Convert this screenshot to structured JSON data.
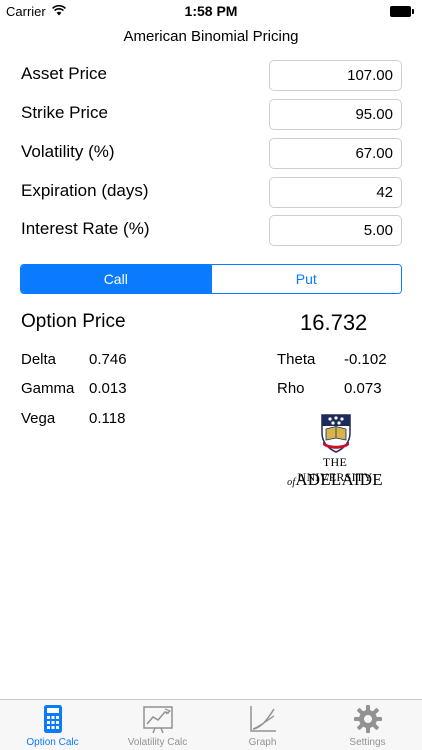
{
  "status_bar": {
    "carrier": "Carrier",
    "time": "1:58 PM"
  },
  "title": "American Binomial Pricing",
  "inputs": [
    {
      "label": "Asset Price",
      "value": "107.00"
    },
    {
      "label": "Strike Price",
      "value": "95.00"
    },
    {
      "label": "Volatility (%)",
      "value": "67.00"
    },
    {
      "label": "Expiration (days)",
      "value": "42"
    },
    {
      "label": "Interest Rate (%)",
      "value": "5.00"
    }
  ],
  "segments": {
    "call": "Call",
    "put": "Put",
    "selected": "Call"
  },
  "result": {
    "label": "Option Price",
    "value": "16.732"
  },
  "greeks": {
    "delta": {
      "label": "Delta",
      "value": "0.746"
    },
    "gamma": {
      "label": "Gamma",
      "value": "0.013"
    },
    "vega": {
      "label": "Vega",
      "value": "0.118"
    },
    "theta": {
      "label": "Theta",
      "value": "-0.102"
    },
    "rho": {
      "label": "Rho",
      "value": "0.073"
    }
  },
  "logo": {
    "line1": "THE UNIVERSITY",
    "of": "of",
    "name": "ADELAIDE"
  },
  "tabs": [
    {
      "label": "Option Calc",
      "icon": "calculator-icon",
      "active": true
    },
    {
      "label": "Volatility Calc",
      "icon": "trend-chart-icon",
      "active": false
    },
    {
      "label": "Graph",
      "icon": "graph-icon",
      "active": false
    },
    {
      "label": "Settings",
      "icon": "gear-icon",
      "active": false
    }
  ],
  "colors": {
    "accent": "#0a7aff",
    "inactive_tab": "#929292",
    "logo_red": "#c8102e",
    "logo_navy": "#1d2b5c",
    "logo_gold": "#d8b24a"
  }
}
